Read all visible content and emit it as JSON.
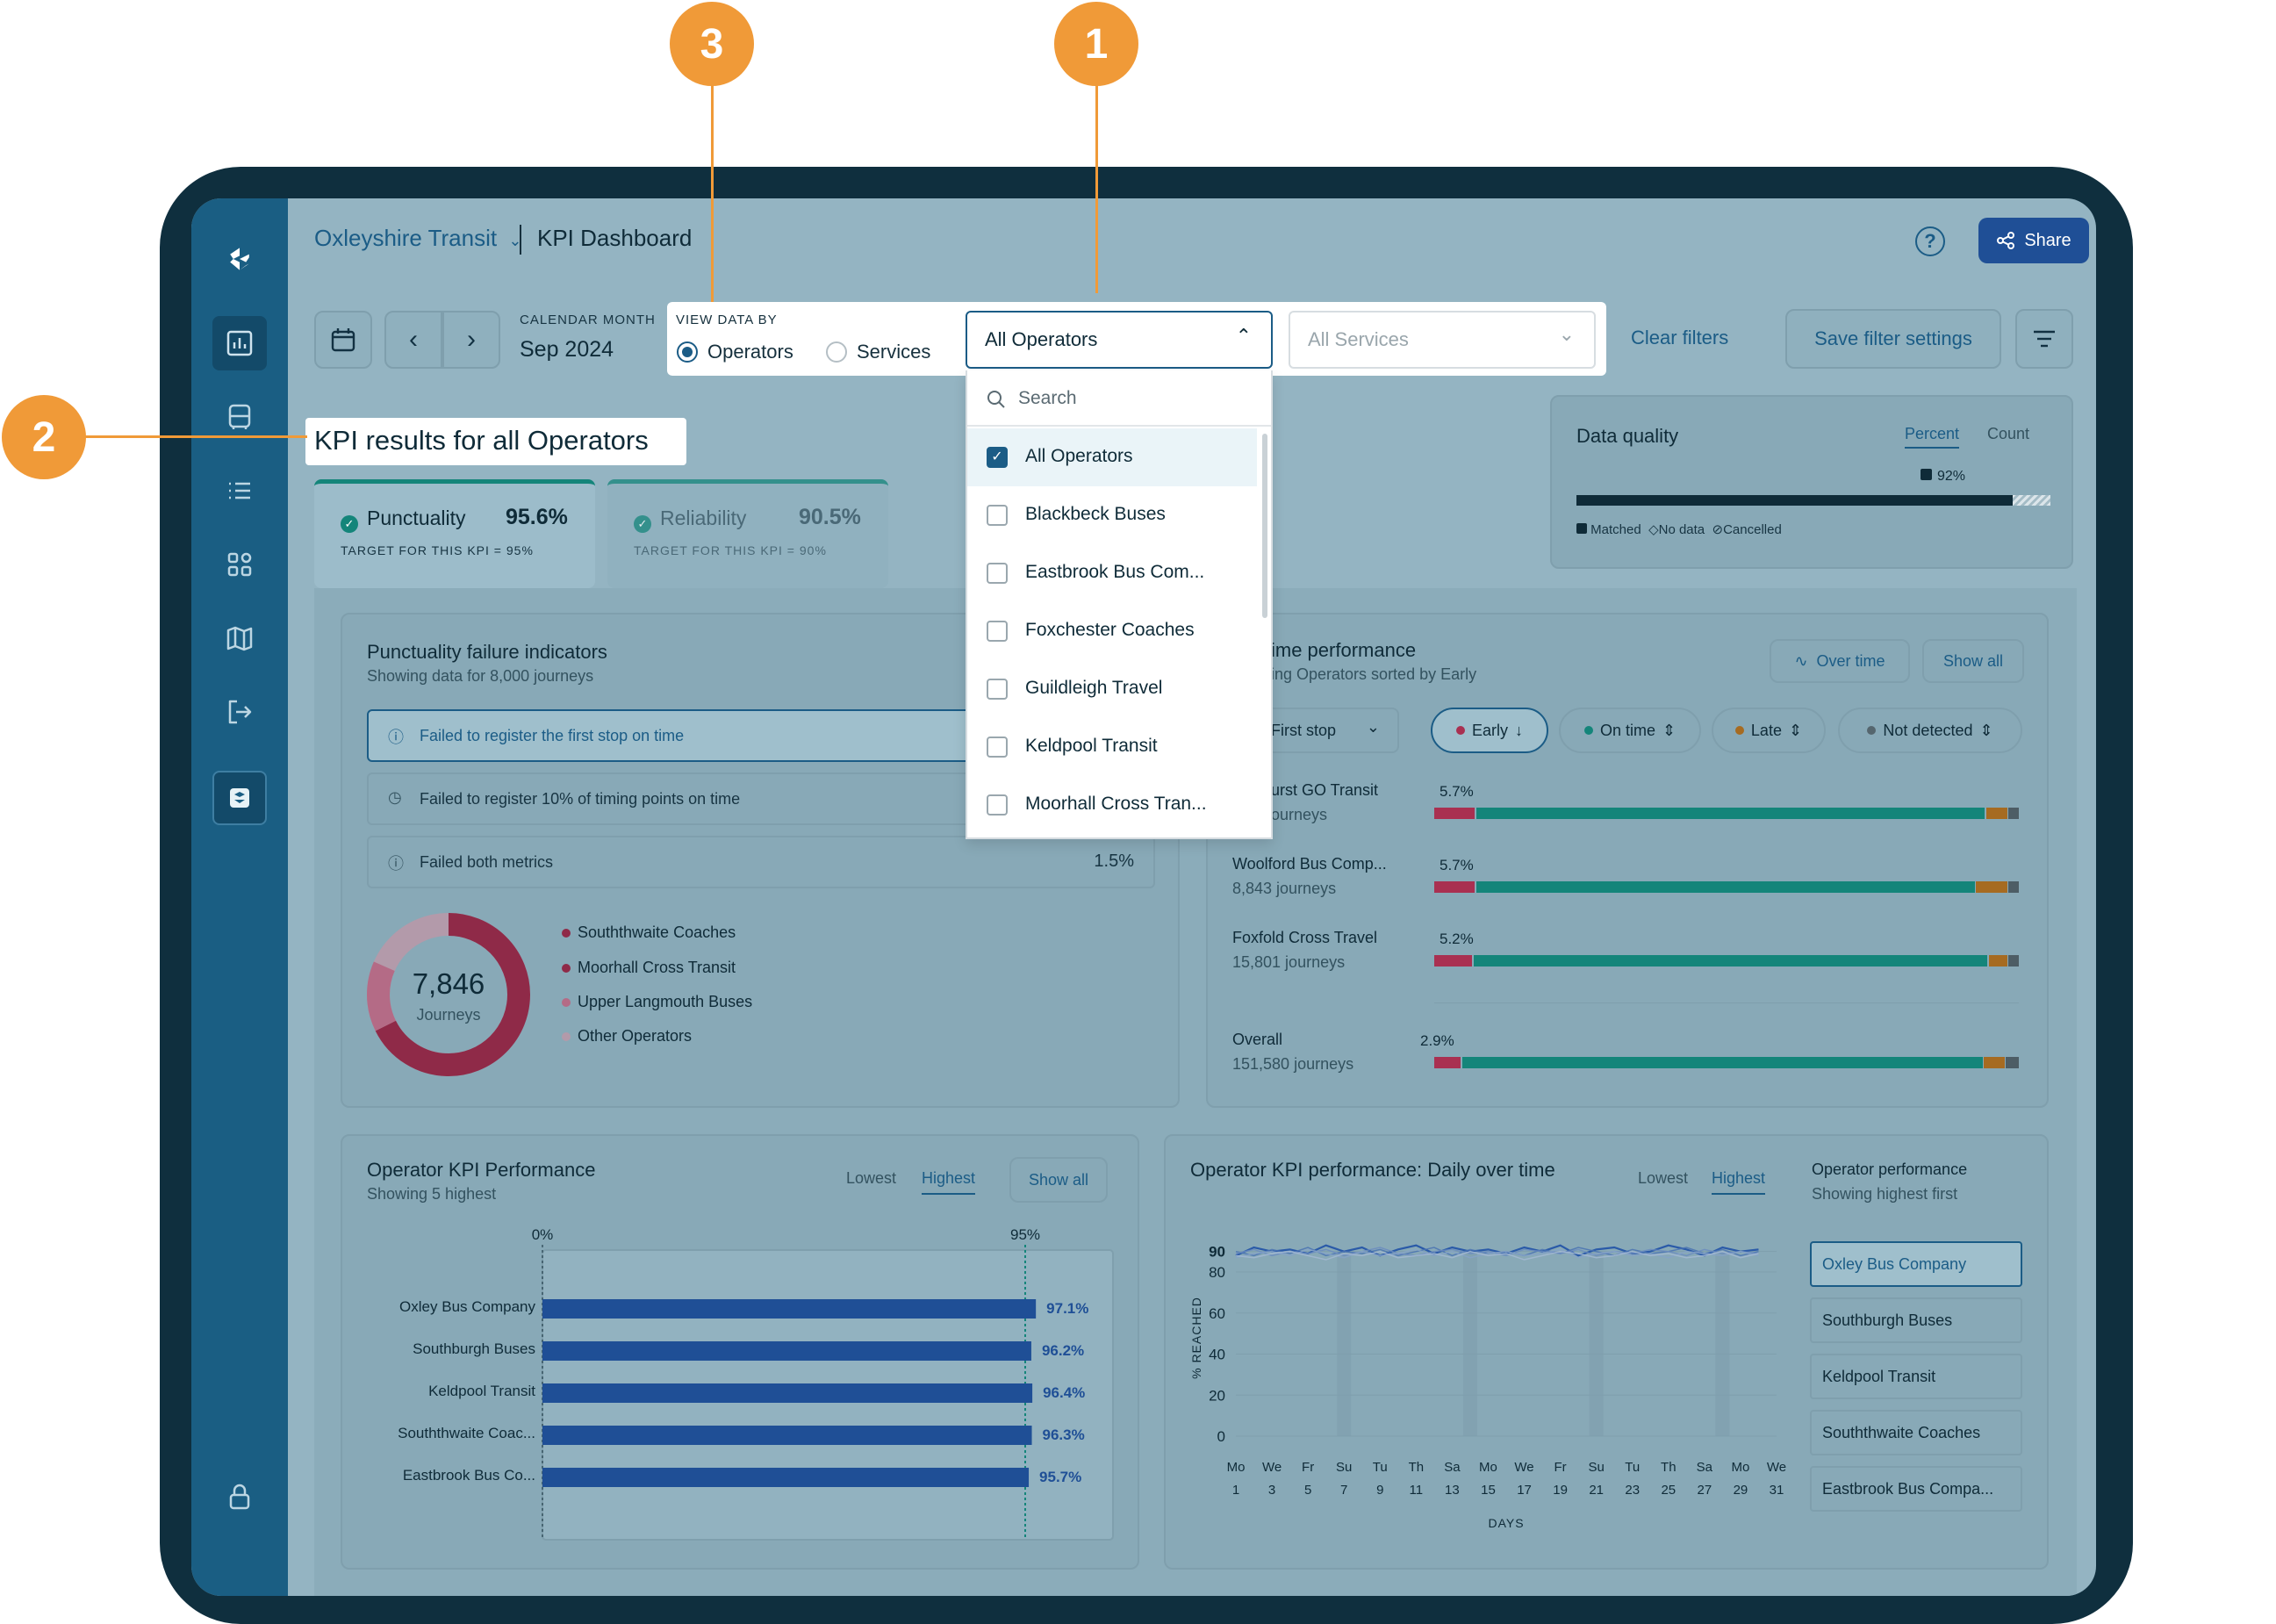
{
  "header": {
    "org": "Oxleyshire Transit",
    "page_title": "KPI Dashboard",
    "share_label": "Share"
  },
  "filters": {
    "calendar_label": "CALENDAR MONTH",
    "month": "Sep 2024",
    "view_by_label": "VIEW DATA BY",
    "view_operators": "Operators",
    "view_services": "Services",
    "operator_select": "All Operators",
    "services_placeholder": "All Services",
    "clear_filters": "Clear filters",
    "save_settings": "Save filter settings"
  },
  "dropdown": {
    "search_placeholder": "Search",
    "options": [
      {
        "label": "All Operators",
        "checked": true
      },
      {
        "label": "Blackbeck Buses",
        "checked": false
      },
      {
        "label": "Eastbrook Bus Com...",
        "checked": false
      },
      {
        "label": "Foxchester Coaches",
        "checked": false
      },
      {
        "label": "Guildleigh Travel",
        "checked": false
      },
      {
        "label": "Keldpool Transit",
        "checked": false
      },
      {
        "label": "Moorhall Cross Tran...",
        "checked": false
      }
    ]
  },
  "results_title": "KPI results for all Operators",
  "kpi_tabs": [
    {
      "name": "Punctuality",
      "value": "95.6%",
      "target": "TARGET FOR THIS KPI = 95%"
    },
    {
      "name": "Reliability",
      "value": "90.5%",
      "target": "TARGET FOR THIS KPI = 90%"
    }
  ],
  "data_quality": {
    "title": "Data quality",
    "tab_percent": "Percent",
    "tab_count": "Count",
    "value_label": "92%",
    "matched_fraction": 0.92,
    "legend": [
      "Matched",
      "No data",
      "Cancelled"
    ]
  },
  "failure": {
    "title": "Punctuality failure indicators",
    "subtitle": "Showing data for 8,000 journeys",
    "items": [
      {
        "label": "Failed to register the first stop on time",
        "value": ""
      },
      {
        "label": "Failed to register 10% of timing points on time",
        "value": ""
      },
      {
        "label": "Failed both metrics",
        "value": "1.5%"
      }
    ],
    "donut_value": "7,846",
    "donut_label": "Journeys",
    "legend": [
      "Souththwaite Coaches",
      "Moorhall Cross Transit",
      "Upper Langmouth Buses",
      "Other Operators"
    ]
  },
  "time_perf": {
    "title": "ime performance",
    "subtitle": "ing Operators sorted by Early",
    "over_time": "Over time",
    "show_all": "Show all",
    "stop_select": "First stop",
    "chips": [
      "Early",
      "On time",
      "Late",
      "Not detected"
    ],
    "rows": [
      {
        "name": "urst GO Transit",
        "journeys": "ourneys",
        "pct": "5.7%",
        "early": 5.7,
        "late": 2.5,
        "nd": 1.0
      },
      {
        "name": "Woolford Bus Comp...",
        "journeys": "8,843 journeys",
        "pct": "5.7%",
        "early": 5.7,
        "late": 4.5,
        "nd": 1.0
      },
      {
        "name": "Foxfold Cross Travel",
        "journeys": "15,801 journeys",
        "pct": "5.2%",
        "early": 5.2,
        "late": 2.0,
        "nd": 1.0
      },
      {
        "name": "Overall",
        "journeys": "151,580 journeys",
        "pct": "2.9%",
        "early": 2.9,
        "late": 2.5,
        "nd": 1.5
      }
    ]
  },
  "operator_kpi": {
    "title": "Operator KPI Performance",
    "subtitle": "Showing 5 highest",
    "tab_lowest": "Lowest",
    "tab_highest": "Highest",
    "show_all": "Show all",
    "axis_start": "0%",
    "axis_target": "95%"
  },
  "daily": {
    "title": "Operator KPI performance: Daily over time",
    "tab_lowest": "Lowest",
    "tab_highest": "Highest",
    "side_title": "Operator performance",
    "side_subtitle": "Showing highest first",
    "operators": [
      "Oxley Bus Company",
      "Southburgh Buses",
      "Keldpool Transit",
      "Souththwaite Coaches",
      "Eastbrook Bus Compa..."
    ],
    "xlabel": "DAYS",
    "ylabel": "% REACHED"
  },
  "chart_data": [
    {
      "type": "bar",
      "categories": [
        "Oxley Bus Company",
        "Southburgh Buses",
        "Keldpool Transit",
        "Souththwaite Coac...",
        "Eastbrook Bus Co..."
      ],
      "values": [
        97.1,
        96.2,
        96.4,
        96.3,
        95.7
      ],
      "value_labels": [
        "97.1%",
        "96.2%",
        "96.4%",
        "96.3%",
        "95.7%"
      ],
      "target": 95,
      "orientation": "horizontal",
      "color": "#1f4f96"
    },
    {
      "type": "line",
      "ylabel": "% REACHED",
      "xlabel": "DAYS",
      "ylim": [
        0,
        95
      ],
      "yticks": [
        0,
        20,
        40,
        60,
        80,
        90
      ],
      "x_days": [
        "Mo",
        "We",
        "Fr",
        "Su",
        "Tu",
        "Th",
        "Sa",
        "Mo",
        "We",
        "Fr",
        "Su",
        "Tu",
        "Th",
        "Sa",
        "Mo",
        "We"
      ],
      "x_dates": [
        "1",
        "3",
        "5",
        "7",
        "9",
        "11",
        "13",
        "15",
        "17",
        "19",
        "21",
        "23",
        "25",
        "27",
        "29",
        "31"
      ],
      "series": [
        {
          "name": "Oxley Bus Company",
          "values": [
            88,
            92,
            90,
            91,
            89,
            93,
            90,
            92,
            88,
            91,
            93,
            89,
            92,
            90,
            91,
            89,
            92,
            90,
            93,
            88,
            91,
            92,
            89,
            90,
            93,
            91,
            88,
            92,
            90,
            91
          ]
        },
        {
          "name": "Southburgh Buses",
          "values": [
            90,
            88,
            91,
            89,
            92,
            88,
            90,
            89,
            91,
            88,
            90,
            92,
            88,
            91,
            89,
            90,
            88,
            91,
            89,
            92,
            90,
            88,
            91,
            89,
            90,
            92,
            89,
            91,
            88,
            90
          ]
        },
        {
          "name": "Keldpool Transit",
          "values": [
            89,
            91,
            88,
            90,
            89,
            91,
            88,
            90,
            92,
            89,
            88,
            90,
            91,
            89,
            90,
            88,
            91,
            90,
            89,
            91,
            88,
            90,
            89,
            91,
            90,
            88,
            91,
            89,
            90,
            89
          ]
        },
        {
          "name": "Souththwaite Coaches",
          "values": [
            87,
            89,
            90,
            88,
            91,
            89,
            87,
            90,
            88,
            89,
            91,
            88,
            90,
            87,
            89,
            90,
            88,
            89,
            91,
            87,
            89,
            90,
            88,
            89,
            87,
            90,
            89,
            88,
            90,
            88
          ]
        },
        {
          "name": "Eastbrook Bus Compa...",
          "values": [
            88,
            87,
            89,
            90,
            88,
            86,
            89,
            88,
            90,
            87,
            88,
            89,
            87,
            90,
            88,
            89,
            86,
            88,
            90,
            89,
            87,
            88,
            90,
            88,
            89,
            87,
            88,
            90,
            87,
            89
          ]
        }
      ],
      "colors": [
        "#2a5aa8",
        "#4a73b3",
        "#6b8cbf",
        "#86a3c8",
        "#a5bad3"
      ]
    }
  ],
  "callouts": [
    "3",
    "1",
    "2"
  ],
  "colors": {
    "sidebar": "#1a5e83",
    "teal": "#14857a",
    "early": "#a93051",
    "late": "#a66b21",
    "primary": "#1f4f96",
    "callout": "#f09a38"
  }
}
